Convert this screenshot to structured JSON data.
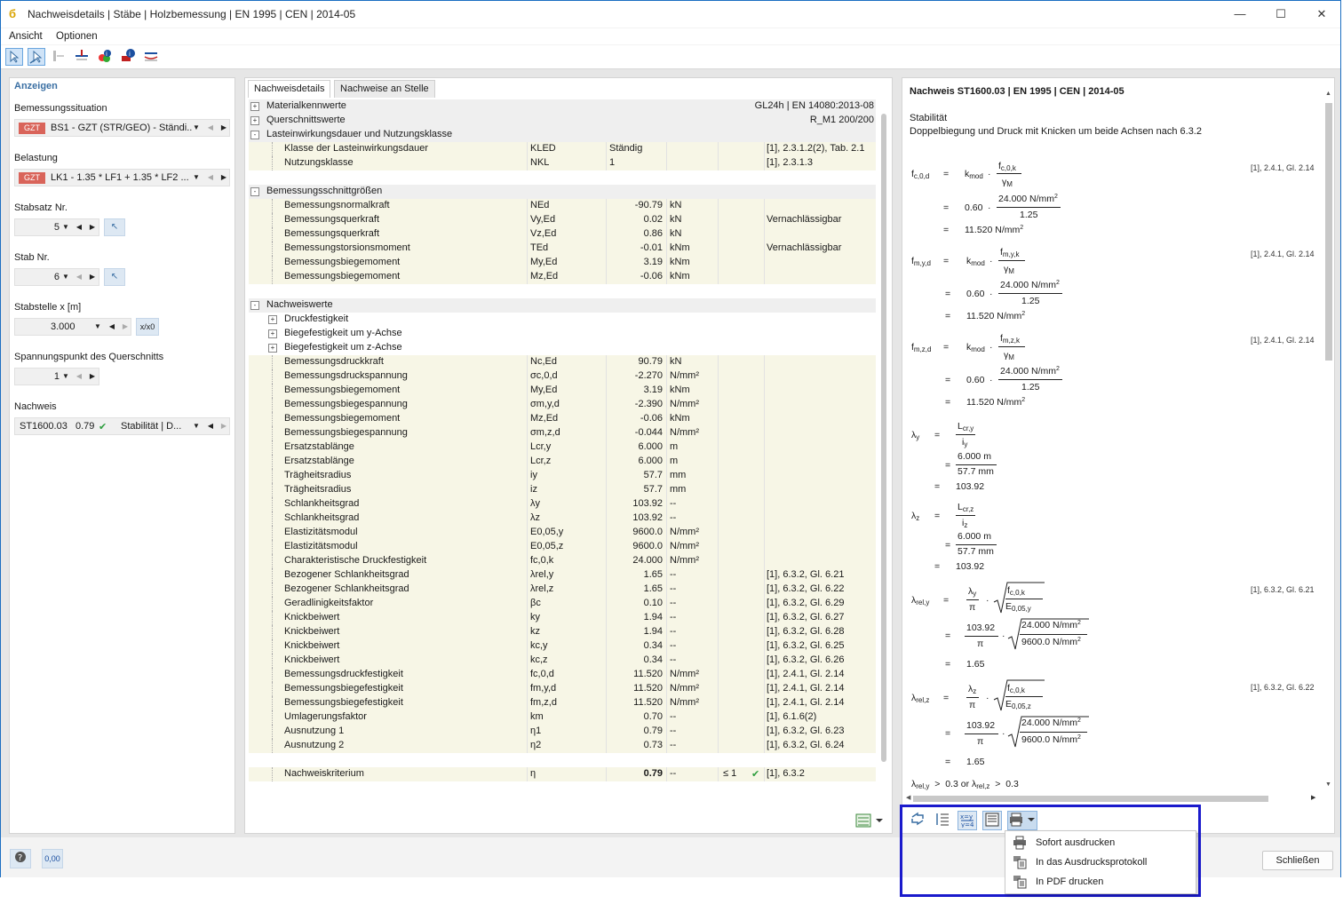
{
  "window": {
    "title": "Nachweisdetails | Stäbe | Holzbemessung | EN 1995 | CEN | 2014-05",
    "minimize": "—",
    "maximize": "☐",
    "close": "✕"
  },
  "menu": {
    "view": "Ansicht",
    "options": "Optionen"
  },
  "left": {
    "header": "Anzeigen",
    "design_situation_label": "Bemessungssituation",
    "design_situation_badge": "GZT",
    "design_situation_value": "BS1 - GZT (STR/GEO) - Ständi...",
    "loading_label": "Belastung",
    "loading_badge": "GZT",
    "loading_value": "LK1 - 1.35 * LF1 + 1.35 * LF2 ...",
    "member_set_label": "Stabsatz Nr.",
    "member_set_value": "5",
    "member_label": "Stab Nr.",
    "member_value": "6",
    "location_label": "Stabstelle x [m]",
    "location_value": "3.000",
    "location_button": "x/x0",
    "stress_point_label": "Spannungspunkt des Querschnitts",
    "stress_point_value": "1",
    "check_label": "Nachweis",
    "check_id": "ST1600.03",
    "check_ratio": "0.79",
    "check_type": "Stabilität | D..."
  },
  "tabs": {
    "details": "Nachweisdetails",
    "at_location": "Nachweise an Stelle"
  },
  "grid": {
    "rows": [
      {
        "type": "sec",
        "exp": "+",
        "name": "Materialkennwerte",
        "sym": "",
        "val": "",
        "unit": "",
        "ok": "",
        "ref": "GL24h | EN 14080:2013-08",
        "refalign": "right"
      },
      {
        "type": "sec",
        "exp": "+",
        "name": "Querschnittswerte",
        "sym": "",
        "val": "",
        "unit": "",
        "ok": "",
        "ref": "R_M1 200/200",
        "refalign": "right"
      },
      {
        "type": "sec",
        "exp": "-",
        "name": "Lasteinwirkungsdauer und Nutzungsklasse",
        "sym": "",
        "val": "",
        "unit": "",
        "ok": "",
        "ref": ""
      },
      {
        "type": "sub",
        "name": "Klasse der Lasteinwirkungsdauer",
        "sym": "KLED",
        "val": "Ständig",
        "valalign": "left",
        "unit": "",
        "ok": "",
        "ref": "[1], 2.3.1.2(2), Tab. 2.1"
      },
      {
        "type": "sub",
        "name": "Nutzungsklasse",
        "sym": "NKL",
        "val": "1",
        "valalign": "left",
        "unit": "",
        "ok": "",
        "ref": "[1], 2.3.1.3"
      },
      {
        "type": "blank"
      },
      {
        "type": "sec",
        "exp": "-",
        "name": "Bemessungsschnittgrößen",
        "sym": "",
        "val": "",
        "unit": "",
        "ok": "",
        "ref": ""
      },
      {
        "type": "sub",
        "name": "Bemessungsnormalkraft",
        "sym": "NEd",
        "val": "-90.79",
        "unit": "kN",
        "ok": "",
        "ref": ""
      },
      {
        "type": "sub",
        "name": "Bemessungsquerkraft",
        "sym": "Vy,Ed",
        "val": "0.02",
        "unit": "kN",
        "ok": "",
        "ref": "Vernachlässigbar"
      },
      {
        "type": "sub",
        "name": "Bemessungsquerkraft",
        "sym": "Vz,Ed",
        "val": "0.86",
        "unit": "kN",
        "ok": "",
        "ref": ""
      },
      {
        "type": "sub",
        "name": "Bemessungstorsionsmoment",
        "sym": "TEd",
        "val": "-0.01",
        "unit": "kNm",
        "ok": "",
        "ref": "Vernachlässigbar"
      },
      {
        "type": "sub",
        "name": "Bemessungsbiegemoment",
        "sym": "My,Ed",
        "val": "3.19",
        "unit": "kNm",
        "ok": "",
        "ref": ""
      },
      {
        "type": "sub",
        "name": "Bemessungsbiegemoment",
        "sym": "Mz,Ed",
        "val": "-0.06",
        "unit": "kNm",
        "ok": "",
        "ref": ""
      },
      {
        "type": "blank"
      },
      {
        "type": "sec",
        "exp": "-",
        "name": "Nachweiswerte",
        "sym": "",
        "val": "",
        "unit": "",
        "ok": "",
        "ref": ""
      },
      {
        "type": "plain",
        "exp": "+",
        "name": "Druckfestigkeit",
        "sym": "",
        "val": "",
        "unit": "",
        "ok": "",
        "ref": ""
      },
      {
        "type": "plain",
        "exp": "+",
        "name": "Biegefestigkeit um y-Achse",
        "sym": "",
        "val": "",
        "unit": "",
        "ok": "",
        "ref": ""
      },
      {
        "type": "plain",
        "exp": "+",
        "name": "Biegefestigkeit um z-Achse",
        "sym": "",
        "val": "",
        "unit": "",
        "ok": "",
        "ref": ""
      },
      {
        "type": "sub",
        "name": "Bemessungsdruckkraft",
        "sym": "Nc,Ed",
        "val": "90.79",
        "unit": "kN",
        "ok": "",
        "ref": ""
      },
      {
        "type": "sub",
        "name": "Bemessungsdruckspannung",
        "sym": "σc,0,d",
        "val": "-2.270",
        "unit": "N/mm²",
        "ok": "",
        "ref": ""
      },
      {
        "type": "sub",
        "name": "Bemessungsbiegemoment",
        "sym": "My,Ed",
        "val": "3.19",
        "unit": "kNm",
        "ok": "",
        "ref": ""
      },
      {
        "type": "sub",
        "name": "Bemessungsbiegespannung",
        "sym": "σm,y,d",
        "val": "-2.390",
        "unit": "N/mm²",
        "ok": "",
        "ref": ""
      },
      {
        "type": "sub",
        "name": "Bemessungsbiegemoment",
        "sym": "Mz,Ed",
        "val": "-0.06",
        "unit": "kNm",
        "ok": "",
        "ref": ""
      },
      {
        "type": "sub",
        "name": "Bemessungsbiegespannung",
        "sym": "σm,z,d",
        "val": "-0.044",
        "unit": "N/mm²",
        "ok": "",
        "ref": ""
      },
      {
        "type": "sub",
        "name": "Ersatzstablänge",
        "sym": "Lcr,y",
        "val": "6.000",
        "unit": "m",
        "ok": "",
        "ref": ""
      },
      {
        "type": "sub",
        "name": "Ersatzstablänge",
        "sym": "Lcr,z",
        "val": "6.000",
        "unit": "m",
        "ok": "",
        "ref": ""
      },
      {
        "type": "sub",
        "name": "Trägheitsradius",
        "sym": "iy",
        "val": "57.7",
        "unit": "mm",
        "ok": "",
        "ref": ""
      },
      {
        "type": "sub",
        "name": "Trägheitsradius",
        "sym": "iz",
        "val": "57.7",
        "unit": "mm",
        "ok": "",
        "ref": ""
      },
      {
        "type": "sub",
        "name": "Schlankheitsgrad",
        "sym": "λy",
        "val": "103.92",
        "unit": "--",
        "ok": "",
        "ref": ""
      },
      {
        "type": "sub",
        "name": "Schlankheitsgrad",
        "sym": "λz",
        "val": "103.92",
        "unit": "--",
        "ok": "",
        "ref": ""
      },
      {
        "type": "sub",
        "name": "Elastizitätsmodul",
        "sym": "E0,05,y",
        "val": "9600.0",
        "unit": "N/mm²",
        "ok": "",
        "ref": ""
      },
      {
        "type": "sub",
        "name": "Elastizitätsmodul",
        "sym": "E0,05,z",
        "val": "9600.0",
        "unit": "N/mm²",
        "ok": "",
        "ref": ""
      },
      {
        "type": "sub",
        "name": "Charakteristische Druckfestigkeit",
        "sym": "fc,0,k",
        "val": "24.000",
        "unit": "N/mm²",
        "ok": "",
        "ref": ""
      },
      {
        "type": "sub",
        "name": "Bezogener Schlankheitsgrad",
        "sym": "λrel,y",
        "val": "1.65",
        "unit": "--",
        "ok": "",
        "ref": "[1], 6.3.2, Gl. 6.21"
      },
      {
        "type": "sub",
        "name": "Bezogener Schlankheitsgrad",
        "sym": "λrel,z",
        "val": "1.65",
        "unit": "--",
        "ok": "",
        "ref": "[1], 6.3.2, Gl. 6.22"
      },
      {
        "type": "sub",
        "name": "Geradlinigkeitsfaktor",
        "sym": "βc",
        "val": "0.10",
        "unit": "--",
        "ok": "",
        "ref": "[1], 6.3.2, Gl. 6.29"
      },
      {
        "type": "sub",
        "name": "Knickbeiwert",
        "sym": "ky",
        "val": "1.94",
        "unit": "--",
        "ok": "",
        "ref": "[1], 6.3.2, Gl. 6.27"
      },
      {
        "type": "sub",
        "name": "Knickbeiwert",
        "sym": "kz",
        "val": "1.94",
        "unit": "--",
        "ok": "",
        "ref": "[1], 6.3.2, Gl. 6.28"
      },
      {
        "type": "sub",
        "name": "Knickbeiwert",
        "sym": "kc,y",
        "val": "0.34",
        "unit": "--",
        "ok": "",
        "ref": "[1], 6.3.2, Gl. 6.25"
      },
      {
        "type": "sub",
        "name": "Knickbeiwert",
        "sym": "kc,z",
        "val": "0.34",
        "unit": "--",
        "ok": "",
        "ref": "[1], 6.3.2, Gl. 6.26"
      },
      {
        "type": "sub",
        "name": "Bemessungsdruckfestigkeit",
        "sym": "fc,0,d",
        "val": "11.520",
        "unit": "N/mm²",
        "ok": "",
        "ref": "[1], 2.4.1, Gl. 2.14"
      },
      {
        "type": "sub",
        "name": "Bemessungsbiegefestigkeit",
        "sym": "fm,y,d",
        "val": "11.520",
        "unit": "N/mm²",
        "ok": "",
        "ref": "[1], 2.4.1, Gl. 2.14"
      },
      {
        "type": "sub",
        "name": "Bemessungsbiegefestigkeit",
        "sym": "fm,z,d",
        "val": "11.520",
        "unit": "N/mm²",
        "ok": "",
        "ref": "[1], 2.4.1, Gl. 2.14"
      },
      {
        "type": "sub",
        "name": "Umlagerungsfaktor",
        "sym": "km",
        "val": "0.70",
        "unit": "--",
        "ok": "",
        "ref": "[1], 6.1.6(2)"
      },
      {
        "type": "sub",
        "name": "Ausnutzung 1",
        "sym": "η1",
        "val": "0.79",
        "unit": "--",
        "ok": "",
        "ref": "[1], 6.3.2, Gl. 6.23"
      },
      {
        "type": "sub",
        "name": "Ausnutzung 2",
        "sym": "η2",
        "val": "0.73",
        "unit": "--",
        "ok": "",
        "ref": "[1], 6.3.2, Gl. 6.24"
      },
      {
        "type": "blank"
      },
      {
        "type": "crit",
        "name": "Nachweiskriterium",
        "sym": "η",
        "val": "0.79",
        "unit": "--",
        "ok": "≤ 1",
        "ref": "[1], 6.3.2"
      }
    ]
  },
  "right": {
    "title": "Nachweis ST1600.03 | EN 1995 | CEN | 2014-05",
    "section": "Stabilität",
    "description": "Doppelbiegung und Druck mit Knicken um beide Achsen nach 6.3.2",
    "ref_1": "[1], 2.4.1, Gl. 2.14",
    "ref_2": "[1], 2.4.1, Gl. 2.14",
    "ref_3": "[1], 2.4.1, Gl. 2.14",
    "ref_4": "[1], 6.3.2, Gl. 6.21",
    "ref_5": "[1], 6.3.2, Gl. 6.22",
    "val_060": "0.60",
    "val_24": "24.000 N/mm",
    "val_125": "1.25",
    "val_11520": "11.520 N/mm",
    "val_6000": "6.000 m",
    "val_577": "57.7 mm",
    "val_10392": "103.92",
    "val_9600": "9600.0 N/mm",
    "val_165": "1.65",
    "val_03": "0.3",
    "or": "or",
    "eq_sign": "=",
    "gt": ">",
    "dot": "·",
    "pi": "π"
  },
  "dropdown": {
    "print_now": "Sofort ausdrucken",
    "to_report": "In das Ausdrucksprotokoll",
    "to_pdf": "In PDF drucken"
  },
  "status": {
    "close": "Schließen",
    "num": "0,00"
  },
  "colors": {
    "accent": "#1b6ec2",
    "badge": "#d9645a",
    "highlight": "#1a1acc",
    "check": "#2e9e3e"
  }
}
